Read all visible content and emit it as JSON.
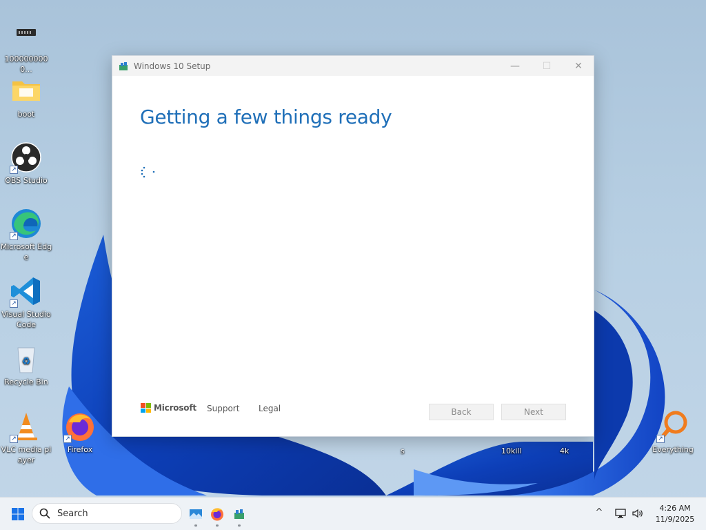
{
  "desktop": {
    "icons": [
      {
        "label": "1000000000...",
        "icon": "drive-icon"
      },
      {
        "label": "boot",
        "icon": "folder-icon"
      },
      {
        "label": "OBS Studio",
        "icon": "obs-icon"
      },
      {
        "label": "Microsoft Edge",
        "icon": "edge-icon"
      },
      {
        "label": "Visual Studio Code",
        "icon": "vscode-icon"
      },
      {
        "label": "Recycle Bin",
        "icon": "recycle-bin-icon"
      },
      {
        "label": "VLC media player",
        "icon": "vlc-icon"
      },
      {
        "label": "Firefox",
        "icon": "firefox-icon"
      },
      {
        "label": "Everything",
        "icon": "everything-icon"
      }
    ],
    "behind_window_labels": [
      "s",
      "10kill",
      "4k"
    ]
  },
  "setup_window": {
    "title": "Windows 10 Setup",
    "heading": "Getting a few things ready",
    "brand": "Microsoft",
    "links": {
      "support": "Support",
      "legal": "Legal"
    },
    "buttons": {
      "back": "Back",
      "next": "Next"
    },
    "controls": {
      "minimize": "—",
      "maximize": "☐",
      "close": "✕"
    }
  },
  "taskbar": {
    "search_label": "Search",
    "tray_chevron": "^",
    "time": "4:26 AM",
    "date": "11/9/2025"
  },
  "colors": {
    "heading_blue": "#1f6fb8",
    "ms_red": "#f25022",
    "ms_green": "#7fba00",
    "ms_blue": "#00a4ef",
    "ms_yellow": "#ffb900"
  }
}
